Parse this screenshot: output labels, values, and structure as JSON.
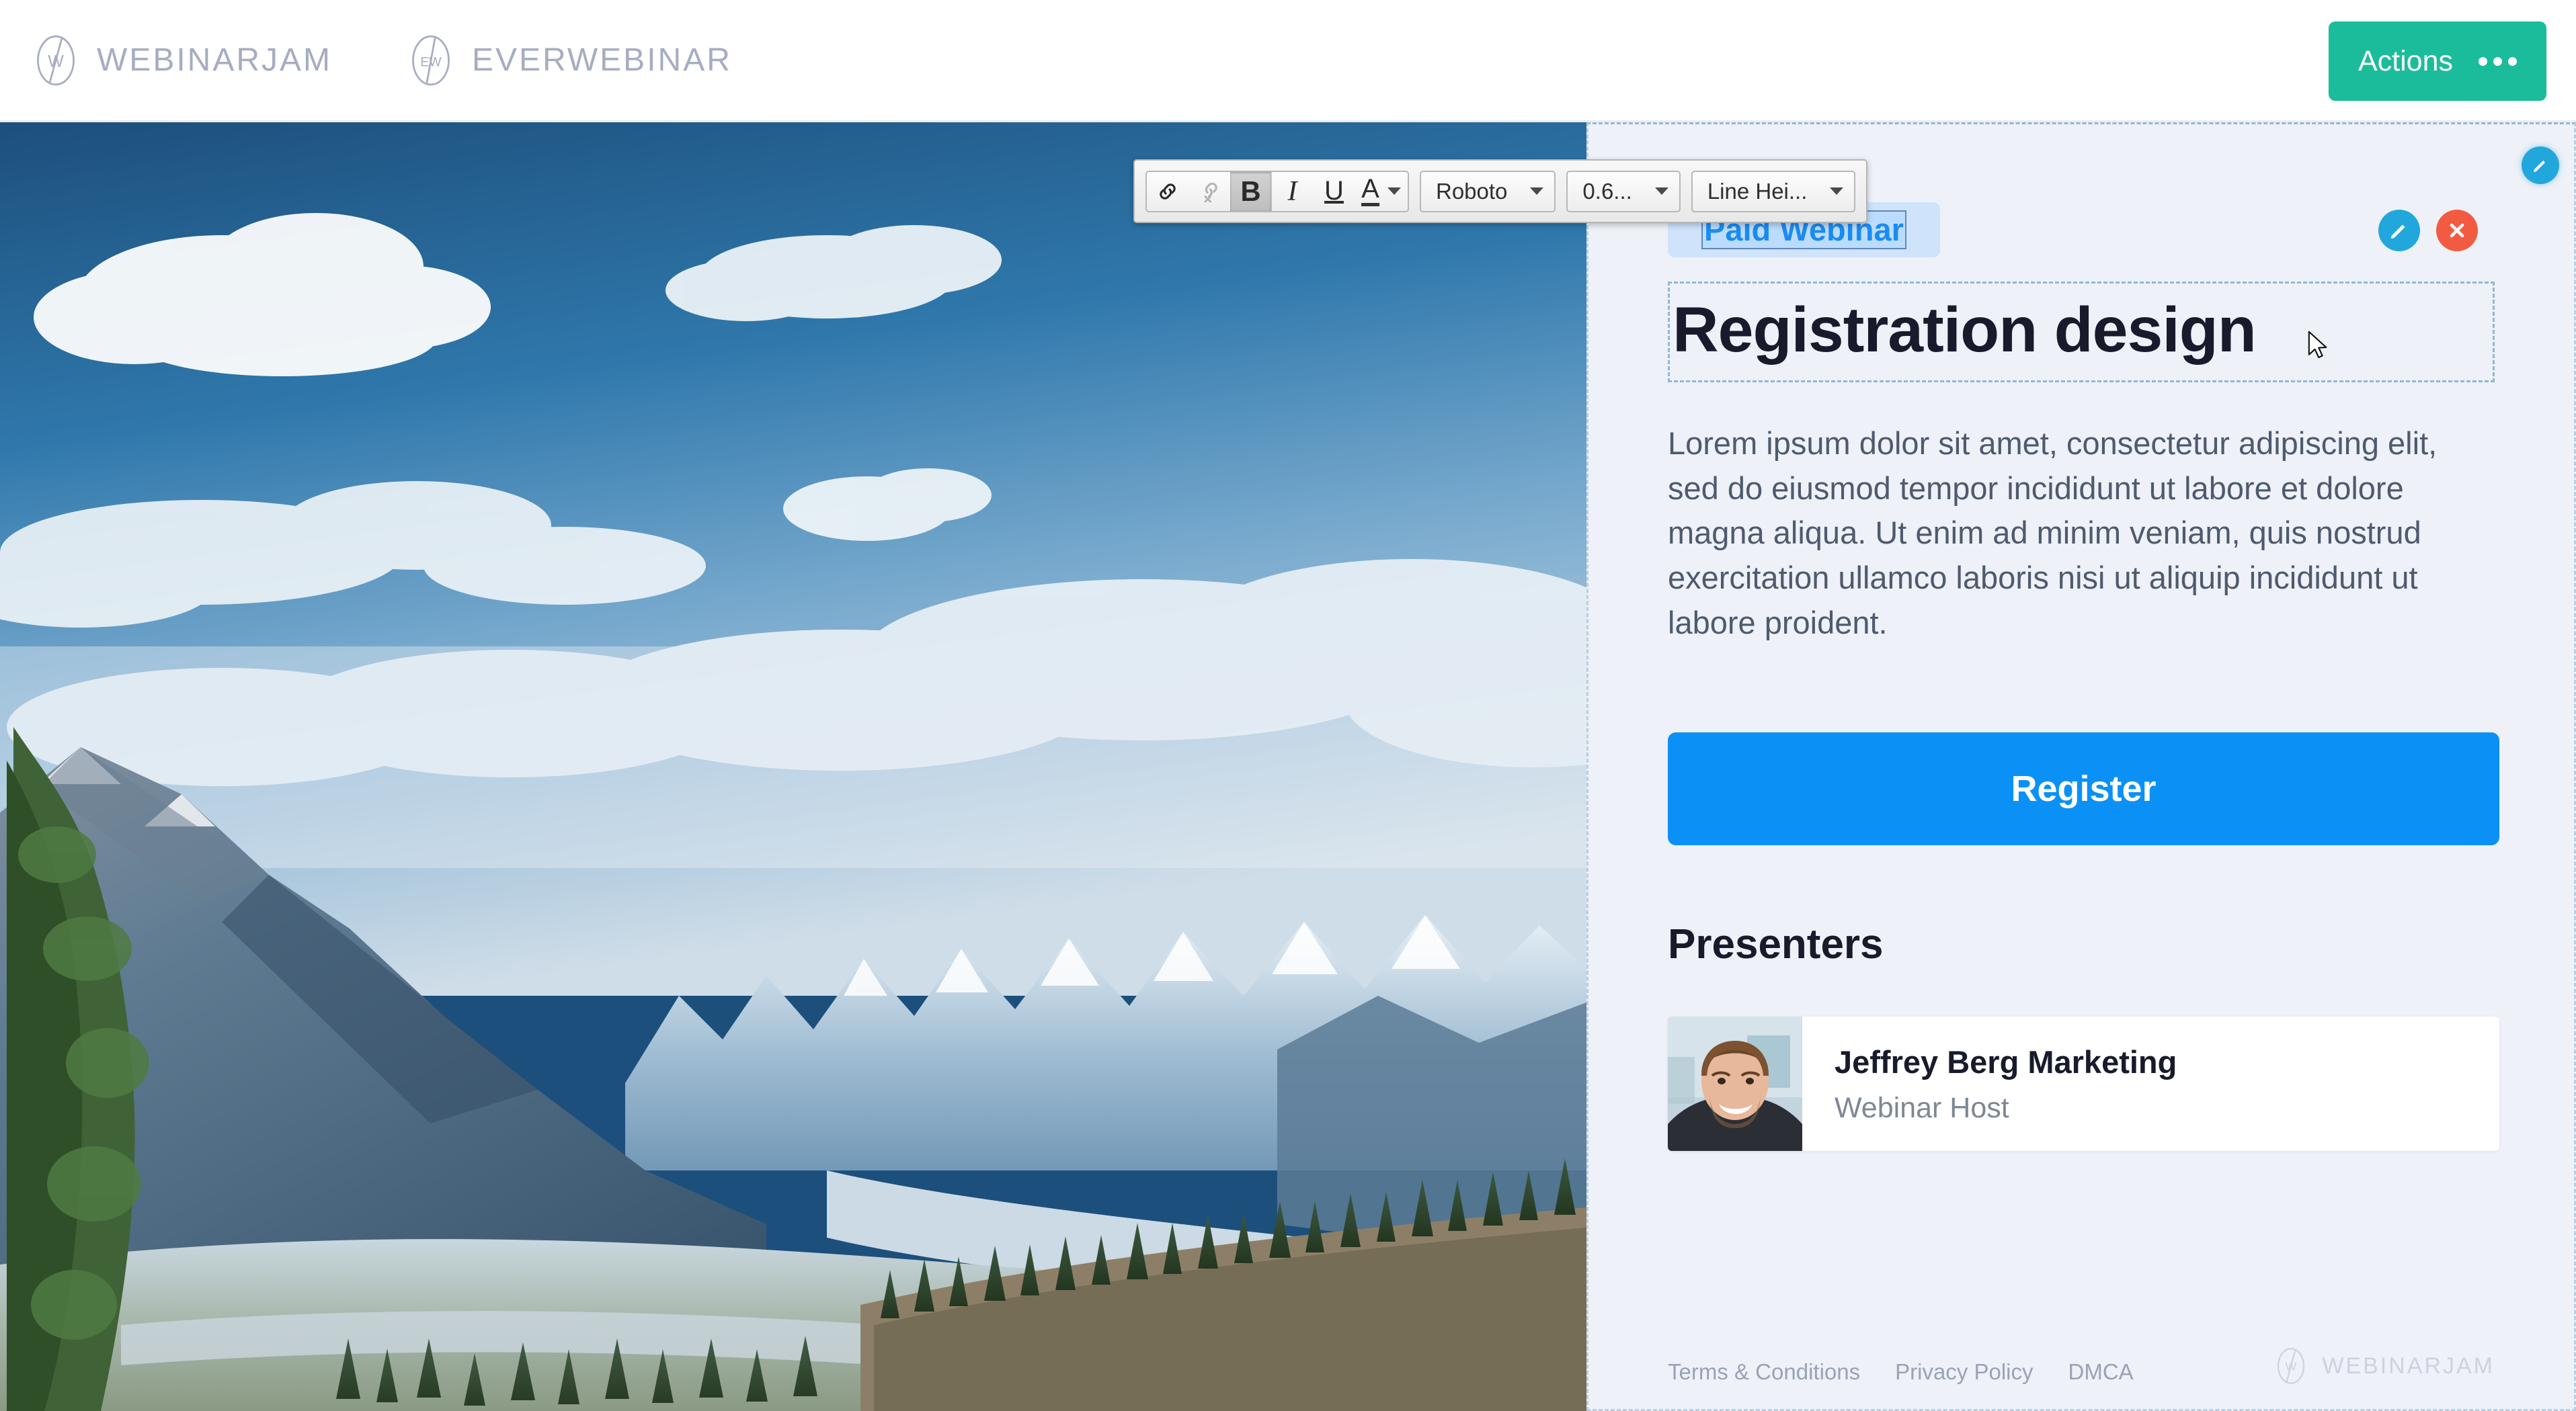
{
  "header": {
    "brands": [
      {
        "mark": "webinarjam-logo-icon",
        "label": "WEBINARJAM"
      },
      {
        "mark": "everwebinar-logo-icon",
        "label": "EVERWEBINAR"
      }
    ],
    "actions_button": {
      "label": "Actions",
      "icon": "ellipsis-icon",
      "color": "#1bbc9b"
    }
  },
  "text_toolbar": {
    "buttons": [
      {
        "name": "insert-link-icon",
        "glyph": "⚭",
        "state": "enabled"
      },
      {
        "name": "remove-link-icon",
        "glyph": "⚭",
        "state": "disabled"
      },
      {
        "name": "bold-button",
        "glyph": "B",
        "state": "active"
      },
      {
        "name": "italic-button",
        "glyph": "I",
        "state": "enabled"
      },
      {
        "name": "underline-button",
        "glyph": "U",
        "state": "enabled"
      },
      {
        "name": "text-color-button",
        "glyph": "A",
        "state": "enabled"
      }
    ],
    "font_family": "Roboto",
    "font_size": "0.6...",
    "line_height": "Line Hei..."
  },
  "hero": {
    "alt": "mountain-valley-landscape-photo",
    "sky_color": "#2a6da6",
    "mountain_color": "#4a6b8a"
  },
  "panel": {
    "edit_fab_icon": "pencil-icon",
    "badge": {
      "text": "Paid Webinar",
      "bg": "#cfe3fb",
      "color": "#1a8cf0"
    },
    "heading": "Registration design",
    "heading_tools": [
      {
        "name": "edit-heading-icon",
        "glyph": "✎",
        "color": "#22a7dd"
      },
      {
        "name": "delete-heading-icon",
        "glyph": "✕",
        "color": "#f25b42"
      }
    ],
    "body": "Lorem ipsum dolor sit amet, consectetur adipiscing elit, sed do eiusmod tempor incididunt ut labore et dolore magna aliqua. Ut enim ad minim veniam, quis nostrud exercitation ullamco laboris nisi ut aliquip incididunt ut labore proident.",
    "register_button": {
      "label": "Register",
      "color": "#0b91f5"
    },
    "presenters_title": "Presenters",
    "presenters": [
      {
        "name": "Jeffrey Berg Marketing",
        "role": "Webinar Host",
        "avatar": "presenter-headshot"
      }
    ],
    "footer": {
      "links": [
        "Terms & Conditions",
        "Privacy Policy",
        "DMCA"
      ],
      "logo_label": "WEBINARJAM",
      "logo_icon": "webinarjam-logo-icon"
    }
  }
}
